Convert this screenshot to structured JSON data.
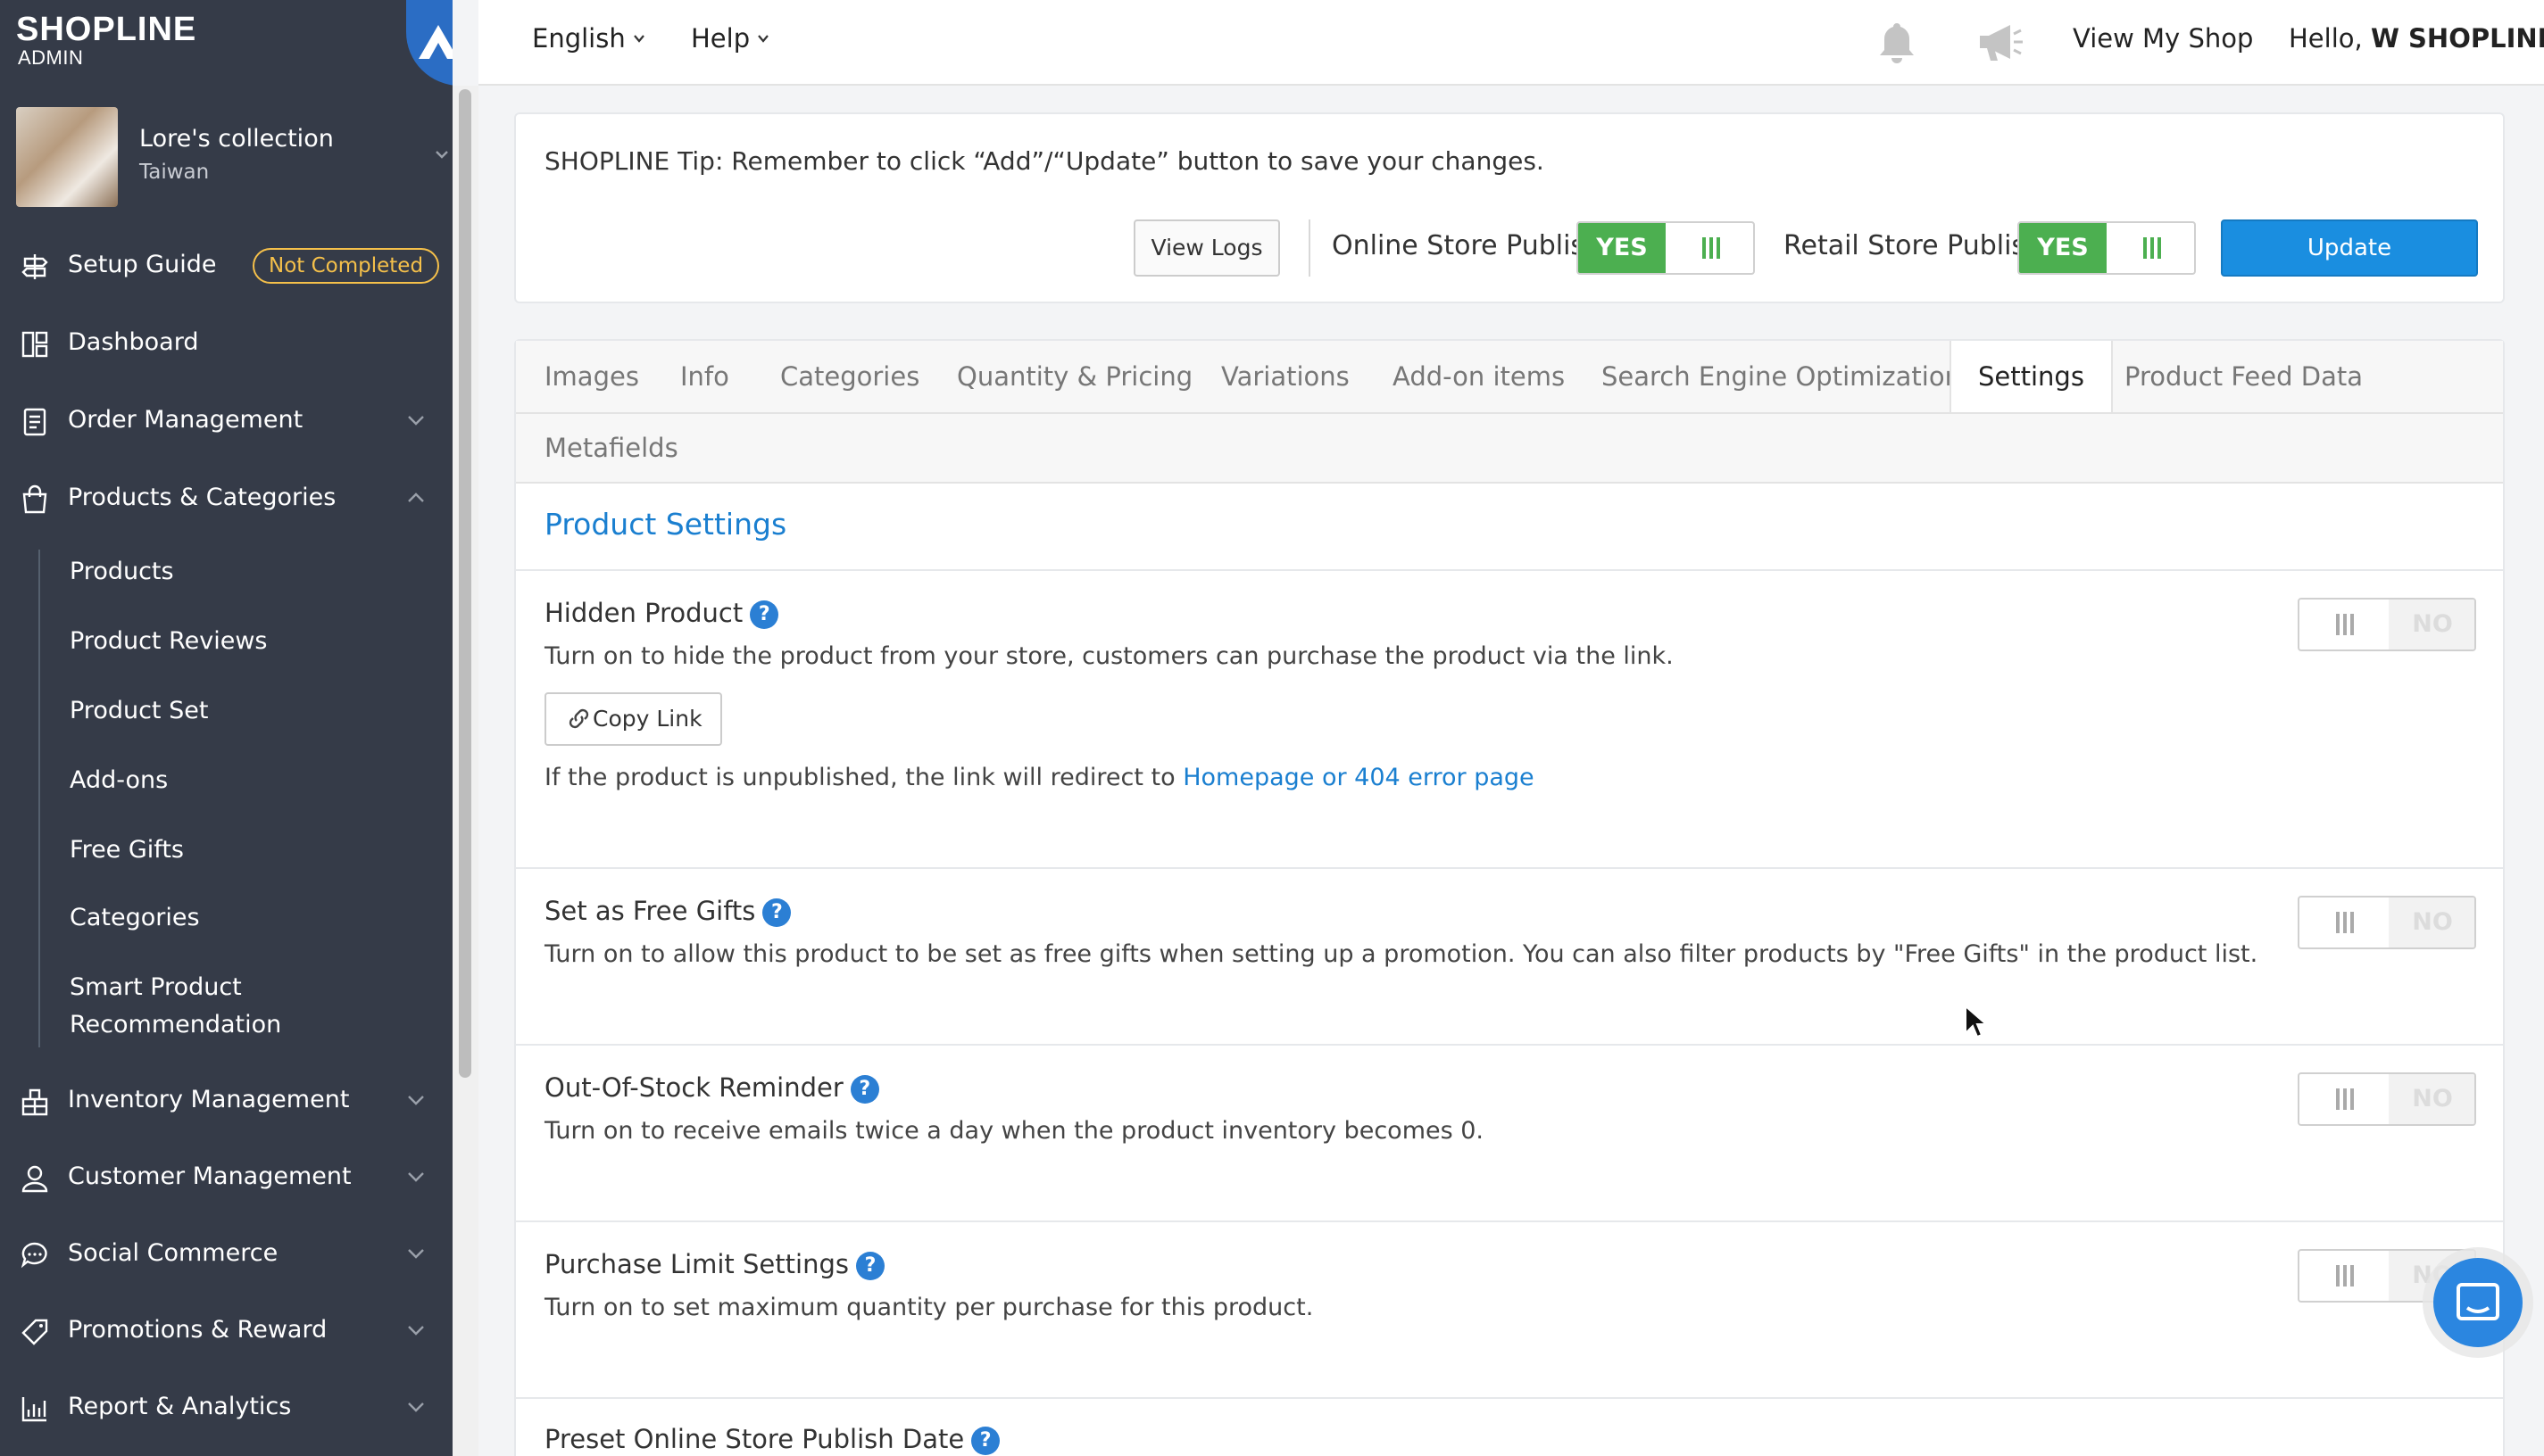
{
  "brand": {
    "name": "SHOPLINE",
    "sub": "ADMIN"
  },
  "store": {
    "name": "Lore's collection",
    "region": "Taiwan"
  },
  "nav": {
    "setup_guide": "Setup Guide",
    "setup_badge": "Not Completed",
    "dashboard": "Dashboard",
    "order_management": "Order Management",
    "products_categories": "Products & Categories",
    "sub_items": [
      "Products",
      "Product Reviews",
      "Product Set",
      "Add-ons",
      "Free Gifts",
      "Categories",
      "Smart Product",
      "Recommendation"
    ],
    "inventory_management": "Inventory Management",
    "customer_management": "Customer Management",
    "social_commerce": "Social Commerce",
    "promotions_reward": "Promotions & Reward",
    "report_analytics": "Report & Analytics"
  },
  "topbar": {
    "language": "English",
    "help": "Help",
    "view_shop": "View My Shop",
    "hello_prefix": "Hello, ",
    "user_name": "W SHOPLINE"
  },
  "tipcard": {
    "tip": "SHOPLINE Tip: Remember to click “Add”/“Update” button to save your changes.",
    "view_logs": "View Logs",
    "online_publish_label": "Online Store Publish",
    "online_publish_value": "YES",
    "retail_publish_label": "Retail Store Publish",
    "retail_publish_value": "YES",
    "update": "Update"
  },
  "tabs": [
    "Images",
    "Info",
    "Categories",
    "Quantity & Pricing",
    "Variations",
    "Add-on items",
    "Search Engine Optimization",
    "Settings",
    "Product Feed Data",
    "Metafields"
  ],
  "active_tab": "Settings",
  "settings": {
    "section_title": "Product Settings",
    "toggle_off_label": "NO",
    "hidden_product": {
      "title": "Hidden Product",
      "desc": "Turn on to hide the product from your store, customers can purchase the product via the link.",
      "copy_link": "Copy Link",
      "redirect_text": "If the product is unpublished, the link will redirect to ",
      "redirect_link": "Homepage or 404 error page"
    },
    "free_gifts": {
      "title": "Set as Free Gifts",
      "desc": "Turn on to allow this product to be set as free gifts when setting up a promotion. You can also filter products by \"Free Gifts\" in the product list."
    },
    "out_of_stock": {
      "title": "Out-Of-Stock Reminder",
      "desc": "Turn on to receive emails twice a day when the product inventory becomes 0."
    },
    "purchase_limit": {
      "title": "Purchase Limit Settings",
      "desc": "Turn on to set maximum quantity per purchase for this product."
    },
    "preset_publish": {
      "title": "Preset Online Store Publish Date"
    }
  },
  "help_glyph": "?",
  "colors": {
    "sidebar": "#353b48",
    "accent": "#1a8ee0",
    "yes_green": "#4caf50",
    "badge": "#f5c04a"
  }
}
